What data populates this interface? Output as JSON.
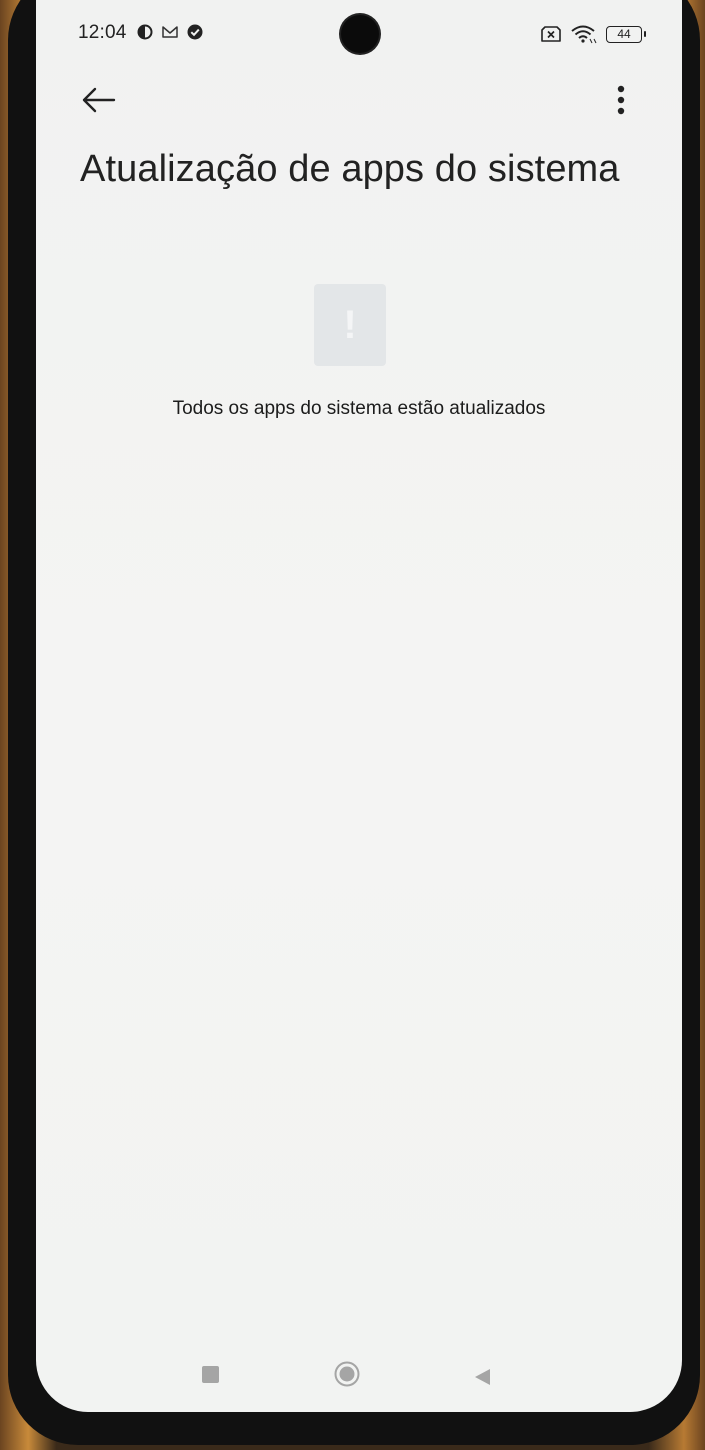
{
  "status_bar": {
    "time": "12:04",
    "battery_level": "44",
    "icons": [
      "data-saver-icon",
      "gmail-icon",
      "check-circle-icon",
      "no-sim-icon",
      "wifi-icon",
      "battery-icon"
    ]
  },
  "toolbar": {
    "back_icon": "arrow-left-icon",
    "more_icon": "more-vert-icon"
  },
  "page": {
    "title": "Atualização de apps do sistema",
    "empty_icon": "exclamation-icon",
    "empty_icon_glyph": "!",
    "empty_message": "Todos os apps do sistema estão atualizados"
  },
  "nav_bar": {
    "buttons": [
      "recents-icon",
      "home-icon",
      "back-icon"
    ]
  },
  "colors": {
    "background": "#f2f3f2",
    "text": "#222222",
    "illustration": "#e3e6e8"
  }
}
